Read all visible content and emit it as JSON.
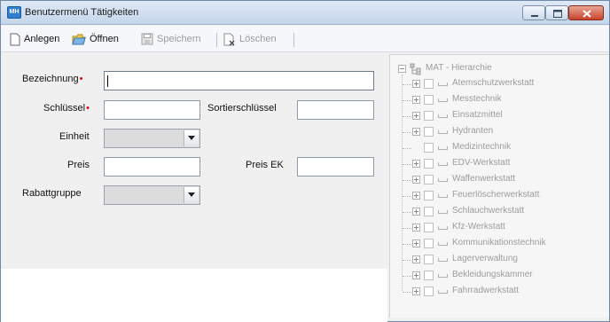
{
  "window": {
    "title": "Benutzermenü Tätigkeiten",
    "app_icon_text": "MH"
  },
  "toolbar": {
    "items": [
      {
        "label": "Anlegen",
        "icon": "new-document-icon",
        "enabled": true
      },
      {
        "label": "Öffnen",
        "icon": "open-folder-icon",
        "enabled": true
      },
      {
        "label": "Speichern",
        "icon": "save-disk-icon",
        "enabled": false
      },
      {
        "label": "Löschen",
        "icon": "delete-document-icon",
        "enabled": false
      }
    ]
  },
  "form": {
    "bezeichnung": {
      "label": "Bezeichnung",
      "required": "•",
      "value": ""
    },
    "schluessel": {
      "label": "Schlüssel",
      "required": "•",
      "value": ""
    },
    "sortierschluessel": {
      "label": "Sortierschlüssel",
      "value": ""
    },
    "einheit": {
      "label": "Einheit",
      "value": ""
    },
    "preis": {
      "label": "Preis",
      "value": ""
    },
    "preis_ek": {
      "label": "Preis EK",
      "value": ""
    },
    "rabattgruppe": {
      "label": "Rabattgruppe",
      "value": ""
    }
  },
  "tree": {
    "root": {
      "label": "MAT - Hierarchie",
      "icon": "hierarchy-icon"
    },
    "items": [
      {
        "label": "Atemschutzwerkstatt",
        "expandable": true
      },
      {
        "label": "Messtechnik",
        "expandable": true
      },
      {
        "label": "Einsatzmittel",
        "expandable": true
      },
      {
        "label": "Hydranten",
        "expandable": true
      },
      {
        "label": "Medizintechnik",
        "expandable": false
      },
      {
        "label": "EDV-Werkstatt",
        "expandable": true
      },
      {
        "label": "Waffenwerkstatt",
        "expandable": true
      },
      {
        "label": "Feuerlöscherwerkstatt",
        "expandable": true
      },
      {
        "label": "Schlauchwerkstatt",
        "expandable": true
      },
      {
        "label": "Kfz-Werkstatt",
        "expandable": true
      },
      {
        "label": "Kommunikationstechnik",
        "expandable": true
      },
      {
        "label": "Lagerverwaltung",
        "expandable": true
      },
      {
        "label": "Bekleidungskammer",
        "expandable": true
      },
      {
        "label": "Fahrradwerkstatt",
        "expandable": true
      }
    ]
  },
  "colors": {
    "accent": "#2f7fd3",
    "required_marker": "#e00000",
    "disabled_text": "#9a9a9a"
  }
}
